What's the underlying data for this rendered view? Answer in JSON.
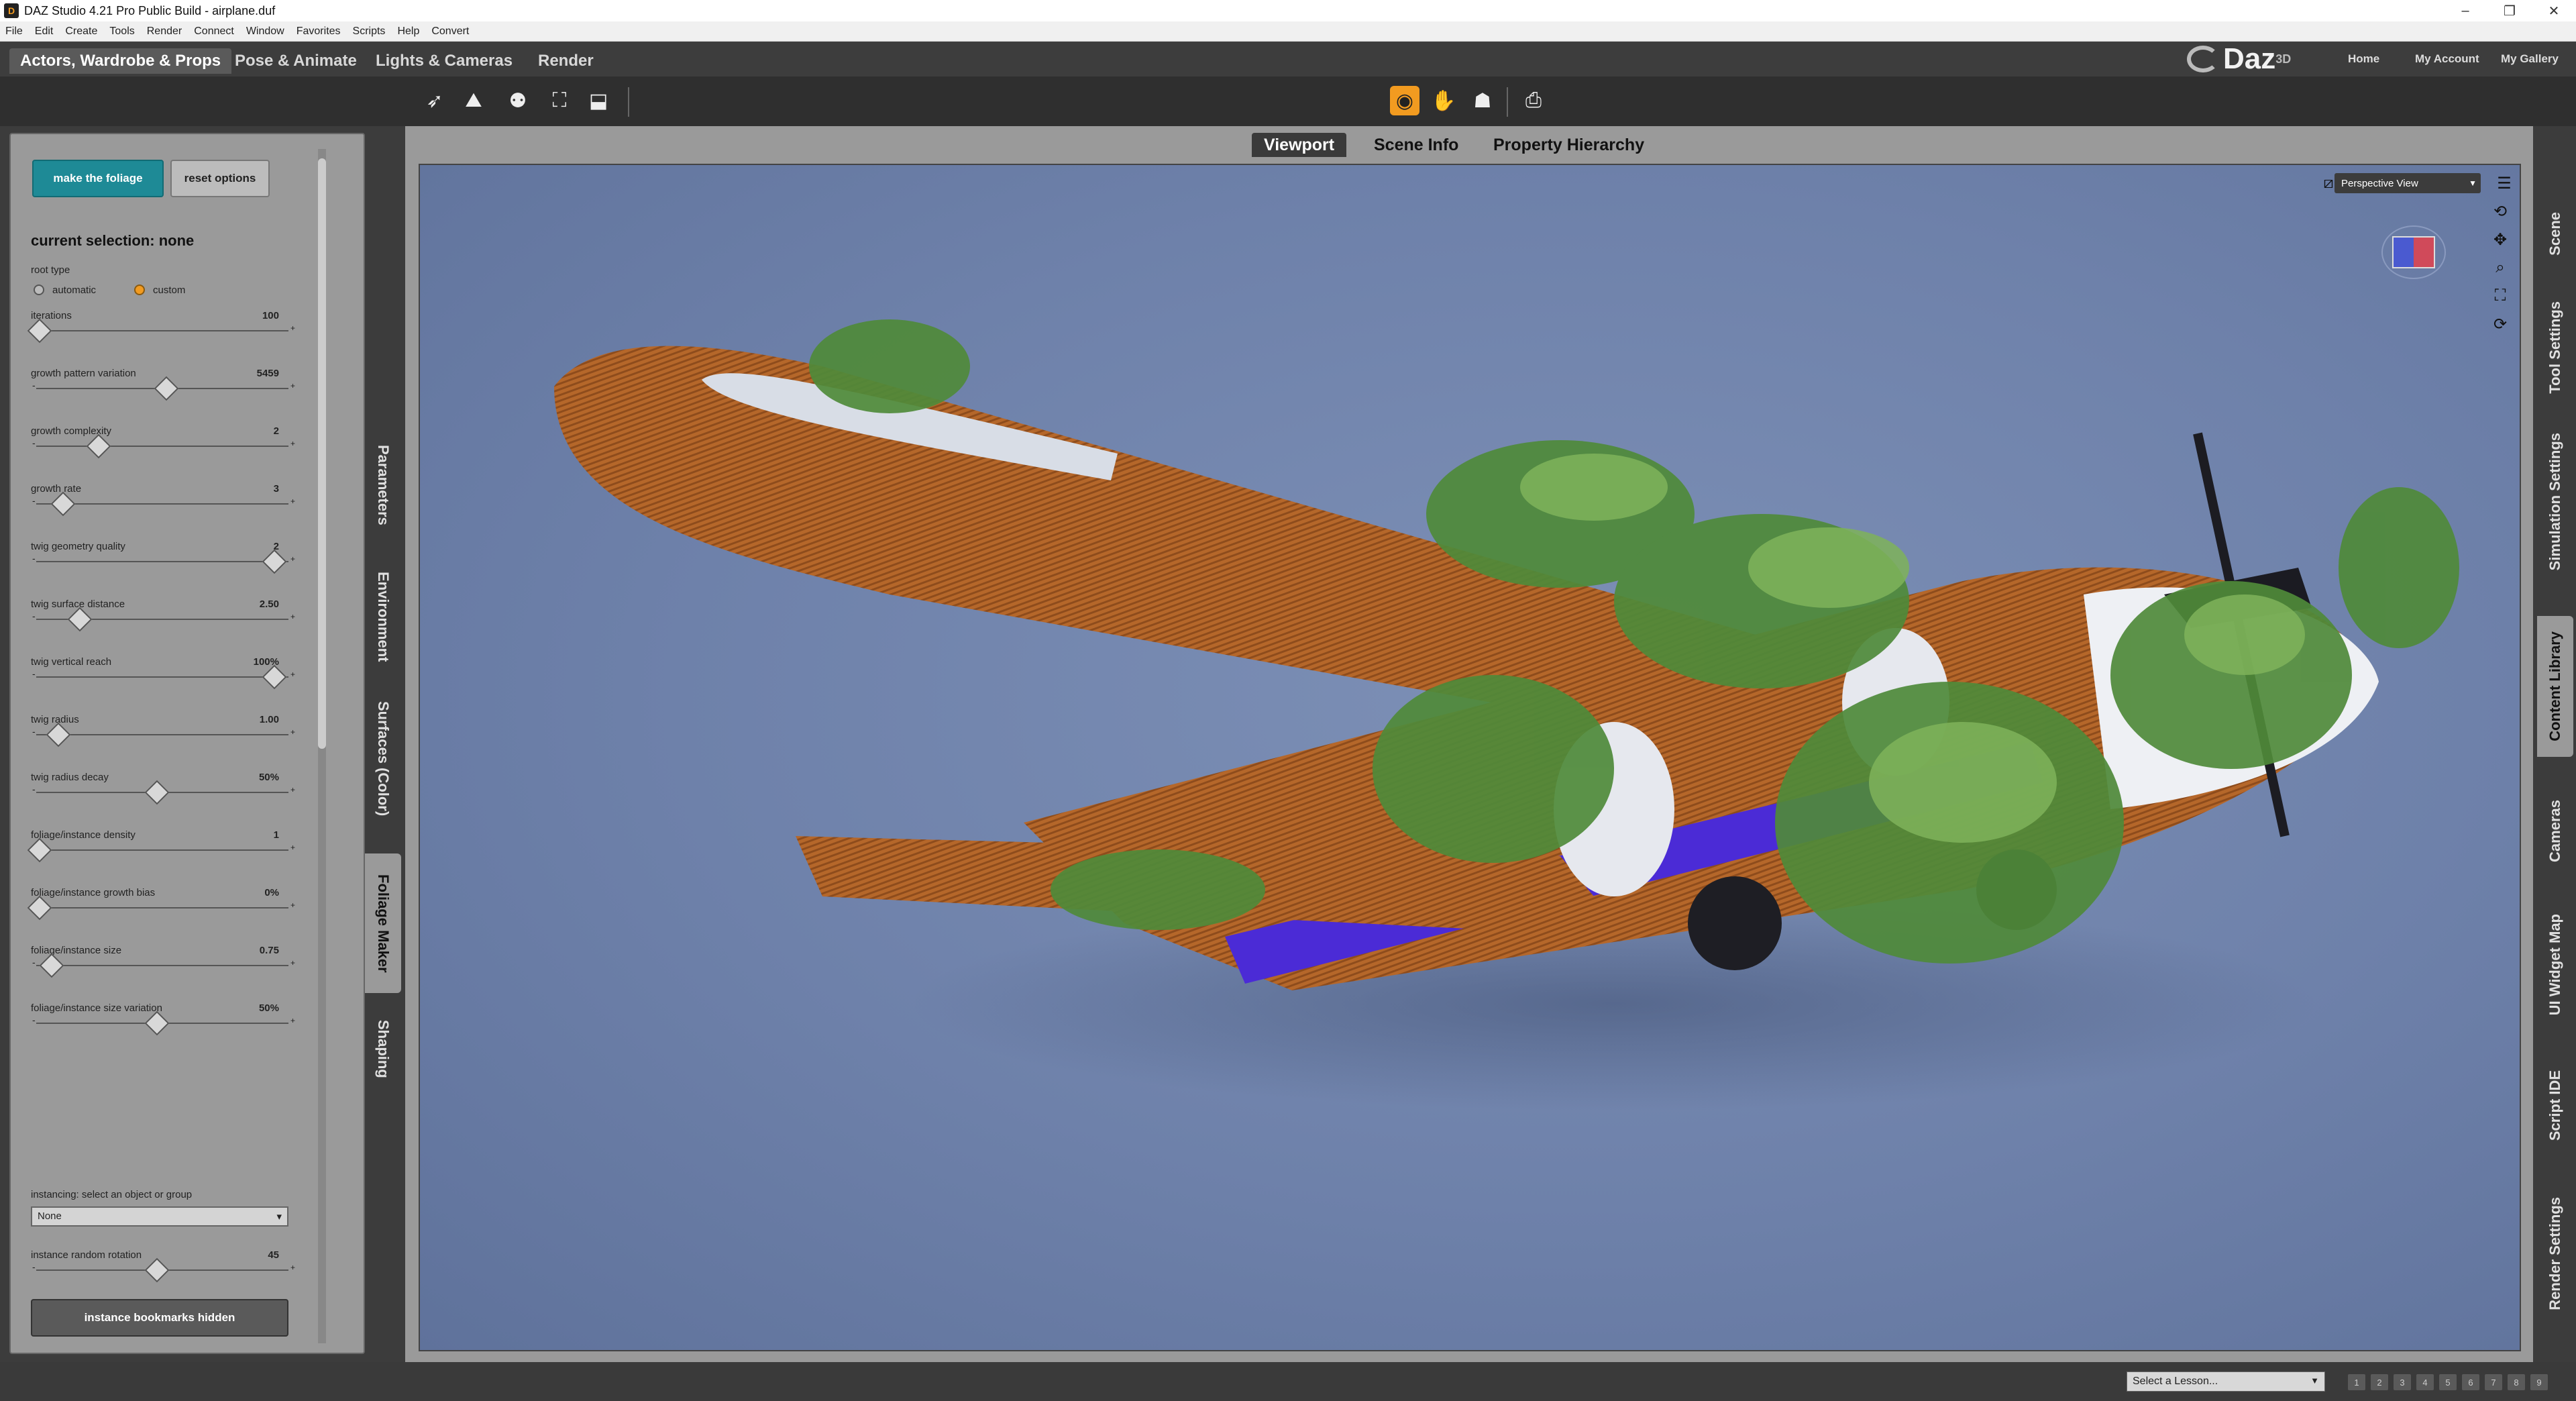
{
  "window": {
    "title": "DAZ Studio 4.21 Pro Public Build - airplane.duf",
    "controls": [
      "–",
      "❐",
      "✕"
    ]
  },
  "menu": [
    "File",
    "Edit",
    "Create",
    "Tools",
    "Render",
    "Connect",
    "Window",
    "Favorites",
    "Scripts",
    "Help",
    "Convert"
  ],
  "rooms": [
    "Actors, Wardrobe & Props",
    "Pose & Animate",
    "Lights & Cameras",
    "Render"
  ],
  "brand": {
    "logo": "Daz",
    "sup": "3D"
  },
  "account_links": [
    "Home",
    "My Account",
    "My Gallery"
  ],
  "toolbar_icons": [
    "node-selection-icon",
    "universal-tool-icon",
    "pose-tool-icon",
    "scene-tool-icon",
    "transform-tool-icon",
    "iray-preview-icon",
    "figure-icon",
    "light-icon",
    "camera-icon"
  ],
  "foliage_panel": {
    "make_button": "make the foliage",
    "reset_button": "reset options",
    "current_selection": "current selection: none",
    "root_type_label": "root type",
    "root_options": [
      "automatic",
      "custom"
    ],
    "root_selected": "custom",
    "sliders": [
      {
        "label": "iterations",
        "value": "100",
        "level": 0.0
      },
      {
        "label": "growth pattern variation",
        "value": "5459",
        "level": 0.54
      },
      {
        "label": "growth complexity",
        "value": "2",
        "level": 0.25
      },
      {
        "label": "growth rate",
        "value": "3",
        "level": 0.1
      },
      {
        "label": "twig geometry quality",
        "value": "2",
        "level": 1.0
      },
      {
        "label": "twig surface distance",
        "value": "2.50",
        "level": 0.17
      },
      {
        "label": "twig vertical reach",
        "value": "100%",
        "level": 1.0
      },
      {
        "label": "twig radius",
        "value": "1.00",
        "level": 0.08
      },
      {
        "label": "twig radius decay",
        "value": "50%",
        "level": 0.5
      },
      {
        "label": "foliage/instance density",
        "value": "1",
        "level": 0.0
      },
      {
        "label": "foliage/instance growth bias",
        "value": "0%",
        "level": 0.0
      },
      {
        "label": "foliage/instance size",
        "value": "0.75",
        "level": 0.05
      },
      {
        "label": "foliage/instance size variation",
        "value": "50%",
        "level": 0.5
      },
      {
        "label": "instance random rotation",
        "value": "45",
        "level": 0.5
      }
    ],
    "instancing_label": "instancing: select an object or group",
    "instancing_value": "None",
    "bookmarks_button": "instance bookmarks hidden"
  },
  "left_tabs": [
    "Parameters",
    "Environment",
    "Surfaces (Color)",
    "Foliage Maker",
    "Shaping"
  ],
  "left_tab_active": "Foliage Maker",
  "viewport_tabs": [
    "Viewport",
    "Scene Info",
    "Property Hierarchy"
  ],
  "viewport": {
    "view_mode": "Perspective View"
  },
  "right_tabs": [
    "Scene",
    "Tool Settings",
    "Simulation Settings",
    "Content Library",
    "Cameras",
    "UI Widget Map",
    "Script IDE",
    "Render Settings"
  ],
  "right_tab_active": "Content Library",
  "status": {
    "lesson_placeholder": "Select a Lesson...",
    "pages": [
      "1",
      "2",
      "3",
      "4",
      "5",
      "6",
      "7",
      "8",
      "9"
    ]
  },
  "colors": {
    "accent": "#f29b20",
    "make_button": "#1e8a96",
    "viewport_bg": "#6e81aa"
  }
}
